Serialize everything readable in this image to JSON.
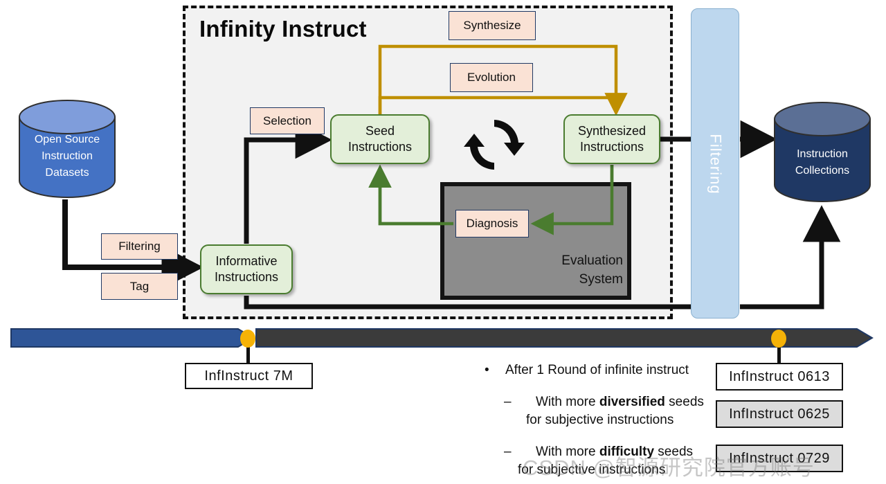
{
  "diagram": {
    "title": "Infinity Instruct",
    "sources": {
      "open_source_label": "Open  Source\nInstruction\nDatasets",
      "open_source_line1": "Open  Source",
      "open_source_line2": "Instruction",
      "open_source_line3": "Datasets",
      "collections_line1": "Instruction",
      "collections_line2": "Collections"
    },
    "process_labels": {
      "filtering": "Filtering",
      "tag": "Tag",
      "selection": "Selection",
      "synthesize": "Synthesize",
      "evolution": "Evolution",
      "diagnosis": "Diagnosis",
      "filtering_bar": "Filtering"
    },
    "nodes": {
      "informative_l1": "Informative",
      "informative_l2": "Instructions",
      "seed_l1": "Seed",
      "seed_l2": "Instructions",
      "synthesized_l1": "Synthesized",
      "synthesized_l2": "Instructions",
      "evaluation_l1": "Evaluation",
      "evaluation_l2": "System"
    },
    "colors": {
      "peach_fill": "#fae2d5",
      "peach_border": "#1f3864",
      "green_fill": "#e3efd9",
      "green_border": "#4a7c2f",
      "gold_arrow": "#bf8f00",
      "green_arrow": "#4a7c2f",
      "filter_bar": "#bdd7ee",
      "eval_gray": "#8c8c8c",
      "cyl_blue": "#4472c4",
      "cyl_navy": "#1f3864",
      "timeline_blue": "#2e5597",
      "timeline_dark": "#3b3b3b",
      "marker_yellow": "#f5b207"
    }
  },
  "timeline": {
    "markers": [
      {
        "label": "InfInstruct  7M",
        "style": "white"
      },
      {
        "label": "InfInstruct  0613",
        "style": "white"
      }
    ],
    "extra_labels": [
      {
        "label": "InfInstruct  0625",
        "style": "gray"
      },
      {
        "label": "InfInstruct  0729",
        "style": "gray"
      }
    ]
  },
  "bullets": {
    "main": "After 1 Round of infinite instruct",
    "sub": [
      {
        "pre": "With more ",
        "bold": "diversified",
        "post": " seeds",
        "line2": "for subjective instructions"
      },
      {
        "pre": "With more ",
        "bold": "difficulty",
        "post": " seeds",
        "line2": "for subjective instructions"
      }
    ],
    "bullet_glyph": "•",
    "dash_glyph": "–"
  },
  "watermark": {
    "text": "CSDN @智源研究院官方账号"
  }
}
